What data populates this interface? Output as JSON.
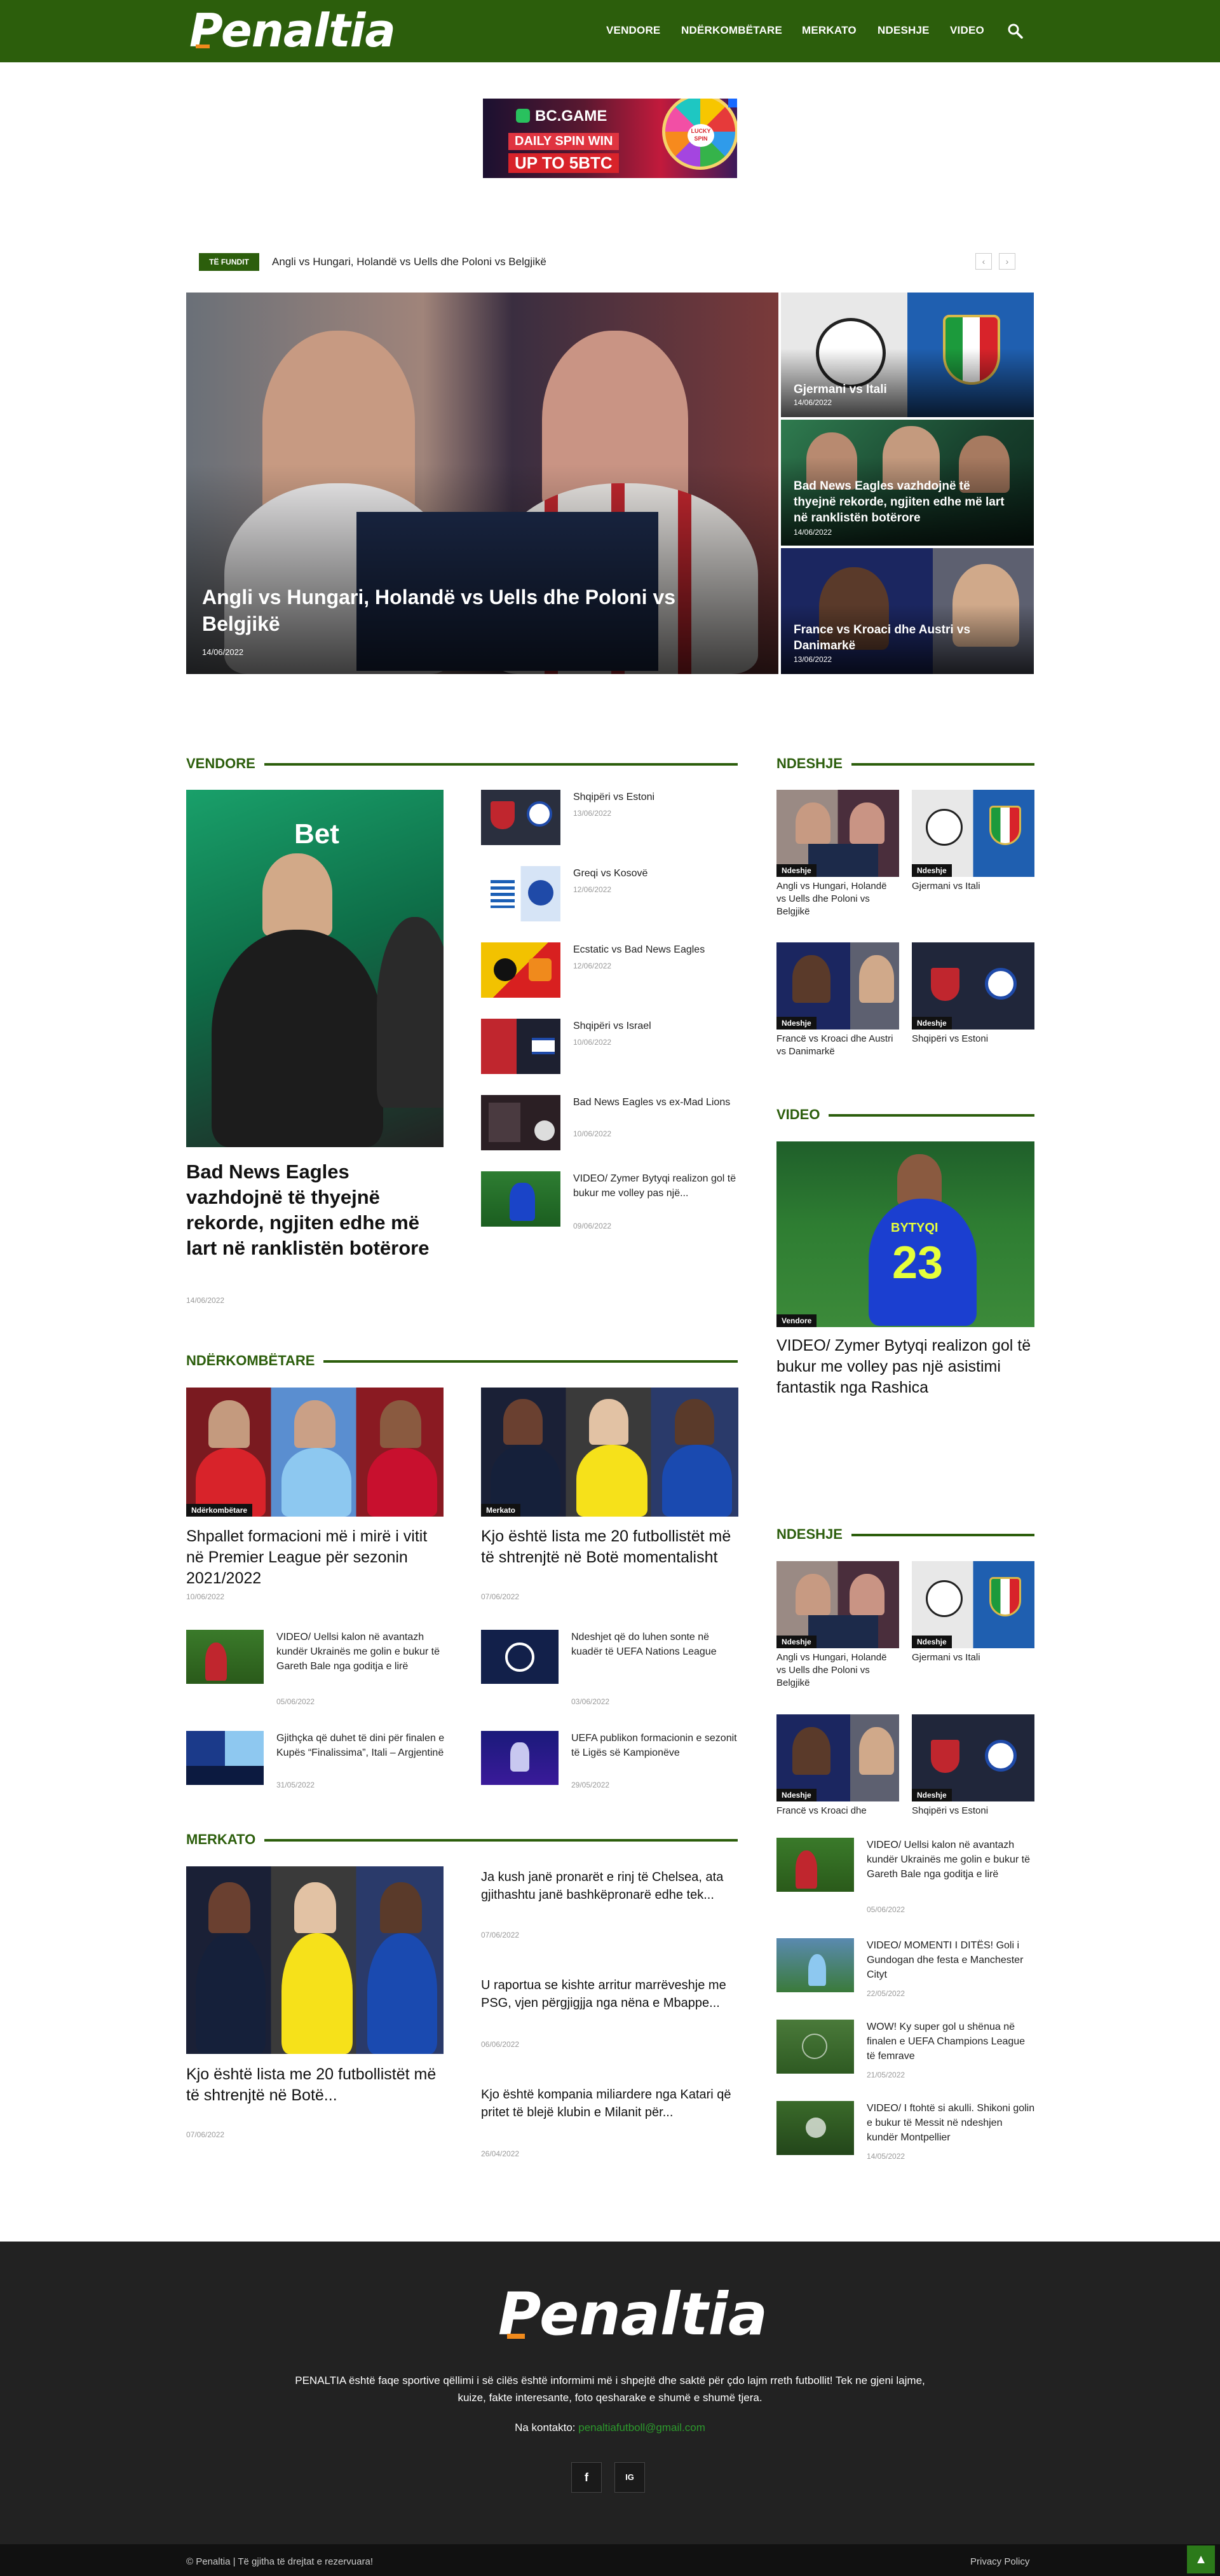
{
  "header": {
    "logo": "Penaltia",
    "nav": [
      "VENDORE",
      "NDËRKOMBËTARE",
      "MERKATO",
      "NDESHJE",
      "VIDEO"
    ]
  },
  "ad": {
    "brand": "BC.GAME",
    "line1": "DAILY SPIN WIN",
    "line2": "UP TO 5BTC",
    "wheel": "LUCKY SPIN"
  },
  "ticker": {
    "badge": "TË FUNDIT",
    "text": "Angli vs Hungari, Holandë vs Uells dhe Poloni vs Belgjikë"
  },
  "hero": {
    "main": {
      "title": "Angli vs Hungari, Holandë vs Uells dhe Poloni vs Belgjikë",
      "date": "14/06/2022"
    },
    "side": [
      {
        "title": "Gjermani vs Itali",
        "date": "14/06/2022"
      },
      {
        "title": "Bad News Eagles vazhdojnë të thyejnë rekorde, ngjiten edhe më lart në ranklistën botërore",
        "date": "14/06/2022"
      },
      {
        "title": "France vs Kroaci dhe Austri vs Danimarkë",
        "date": "13/06/2022"
      }
    ]
  },
  "vendore": {
    "heading": "VENDORE",
    "main": {
      "title": "Bad News Eagles vazhdojnë të thyejnë rekorde, ngjiten edhe më lart në ranklistën botërore",
      "date": "14/06/2022"
    },
    "list": [
      {
        "title": "Shqipëri vs Estoni",
        "date": "13/06/2022"
      },
      {
        "title": "Greqi vs Kosovë",
        "date": "12/06/2022"
      },
      {
        "title": "Ecstatic vs Bad News Eagles",
        "date": "12/06/2022"
      },
      {
        "title": "Shqipëri vs Israel",
        "date": "10/06/2022"
      },
      {
        "title": "Bad News Eagles vs ex-Mad Lions",
        "date": "10/06/2022"
      },
      {
        "title": "VIDEO/ Zymer Bytyqi realizon gol të bukur me volley pas një...",
        "date": "09/06/2022"
      }
    ]
  },
  "ndeshje1": {
    "heading": "NDESHJE",
    "items": [
      {
        "title": "Angli vs Hungari, Holandë vs Uells dhe Poloni vs Belgjikë",
        "badge": "Ndeshje"
      },
      {
        "title": "Gjermani vs Itali",
        "badge": "Ndeshje"
      },
      {
        "title": "Francë vs Kroaci dhe Austri vs Danimarkë",
        "badge": "Ndeshje"
      },
      {
        "title": "Shqipëri vs Estoni",
        "badge": "Ndeshje"
      }
    ]
  },
  "video": {
    "heading": "VIDEO",
    "badge": "Vendore",
    "title": "VIDEO/ Zymer Bytyqi realizon gol të bukur me volley pas një asistimi fantastik nga Rashica",
    "shirt_name": "BYTYQI",
    "shirt_number": "23"
  },
  "nderkombetare": {
    "heading": "NDËRKOMBËTARE",
    "features": [
      {
        "title": "Shpallet formacioni më i mirë i vitit në Premier League për sezonin 2021/2022",
        "date": "10/06/2022",
        "badge": "Ndërkombëtare"
      },
      {
        "title": "Kjo është lista me 20 futbollistët më të shtrenjtë në Botë momentalisht",
        "date": "07/06/2022",
        "badge": "Merkato"
      }
    ],
    "list": [
      {
        "title": "VIDEO/ Uellsi kalon në avantazh kundër Ukrainës me golin e bukur të Gareth Bale nga goditja e lirë",
        "date": "05/06/2022"
      },
      {
        "title": "Ndeshjet që do luhen sonte në kuadër të UEFA Nations League",
        "date": "03/06/2022"
      },
      {
        "title": "Gjithçka që duhet të dini për finalen e Kupës “Finalissima”, Itali – Argjentinë",
        "date": "31/05/2022"
      },
      {
        "title": "UEFA publikon formacionin e sezonit të Ligës së Kampionëve",
        "date": "29/05/2022"
      }
    ]
  },
  "ndeshje2": {
    "heading": "NDESHJE",
    "items": [
      {
        "title": "Angli vs Hungari, Holandë vs Uells dhe Poloni vs Belgjikë",
        "badge": "Ndeshje"
      },
      {
        "title": "Gjermani vs Itali",
        "badge": "Ndeshje"
      },
      {
        "title": "Francë vs Kroaci dhe",
        "badge": "Ndeshje"
      },
      {
        "title": "Shqipëri vs Estoni",
        "badge": "Ndeshje"
      }
    ]
  },
  "merkato": {
    "heading": "MERKATO",
    "main": {
      "title": "Kjo është lista me 20 futbollistët më të shtrenjtë në Botë...",
      "date": "07/06/2022"
    },
    "list": [
      {
        "title": "Ja kush janë pronarët e rinj të Chelsea, ata gjithashtu janë bashkëpronarë edhe tek...",
        "date": "07/06/2022"
      },
      {
        "title": "U raportua se kishte arritur marrëveshje me PSG, vjen përgjigjja nga nëna e Mbappe...",
        "date": "06/06/2022"
      },
      {
        "title": "Kjo është kompania miliardere nga Katari që pritet të blejë klubin e Milanit për...",
        "date": "26/04/2022"
      }
    ]
  },
  "sidebar_videos": [
    {
      "title": "VIDEO/ Uellsi kalon në avantazh kundër Ukrainës me golin e bukur të Gareth Bale nga goditja e lirë",
      "date": "05/06/2022"
    },
    {
      "title": "VIDEO/ MOMENTI I DITËS! Goli i Gundogan dhe festa e Manchester Cityt",
      "date": "22/05/2022"
    },
    {
      "title": "WOW! Ky super gol u shënua në finalen e UEFA Champions League të femrave",
      "date": "21/05/2022"
    },
    {
      "title": "VIDEO/ I ftohtë si akulli. Shikoni golin e bukur të Messit në ndeshjen kundër Montpellier",
      "date": "14/05/2022"
    }
  ],
  "footer": {
    "logo": "Penaltia",
    "description": "PENALTIA është faqe sportive qëllimi i së cilës është informimi më i shpejtë dhe saktë për çdo lajm rreth futbollit! Tek ne gjeni lajme, kuize, fakte interesante, foto qesharake e shumë e shumë tjera.",
    "contact_label": "Na kontakto:",
    "contact_email": "penaltiafutboll@gmail.com",
    "social": [
      "f",
      "IG"
    ],
    "copyright": "© Penaltia | Të gjitha të drejtat e rezervuara!",
    "privacy": "Privacy Policy"
  },
  "colors": {
    "brand_green": "#2c5e0c",
    "footer_bg": "#222222",
    "accent_orange": "#f08a1c"
  },
  "icons": {
    "search": "search-icon",
    "to_top": "arrow-up-icon"
  }
}
